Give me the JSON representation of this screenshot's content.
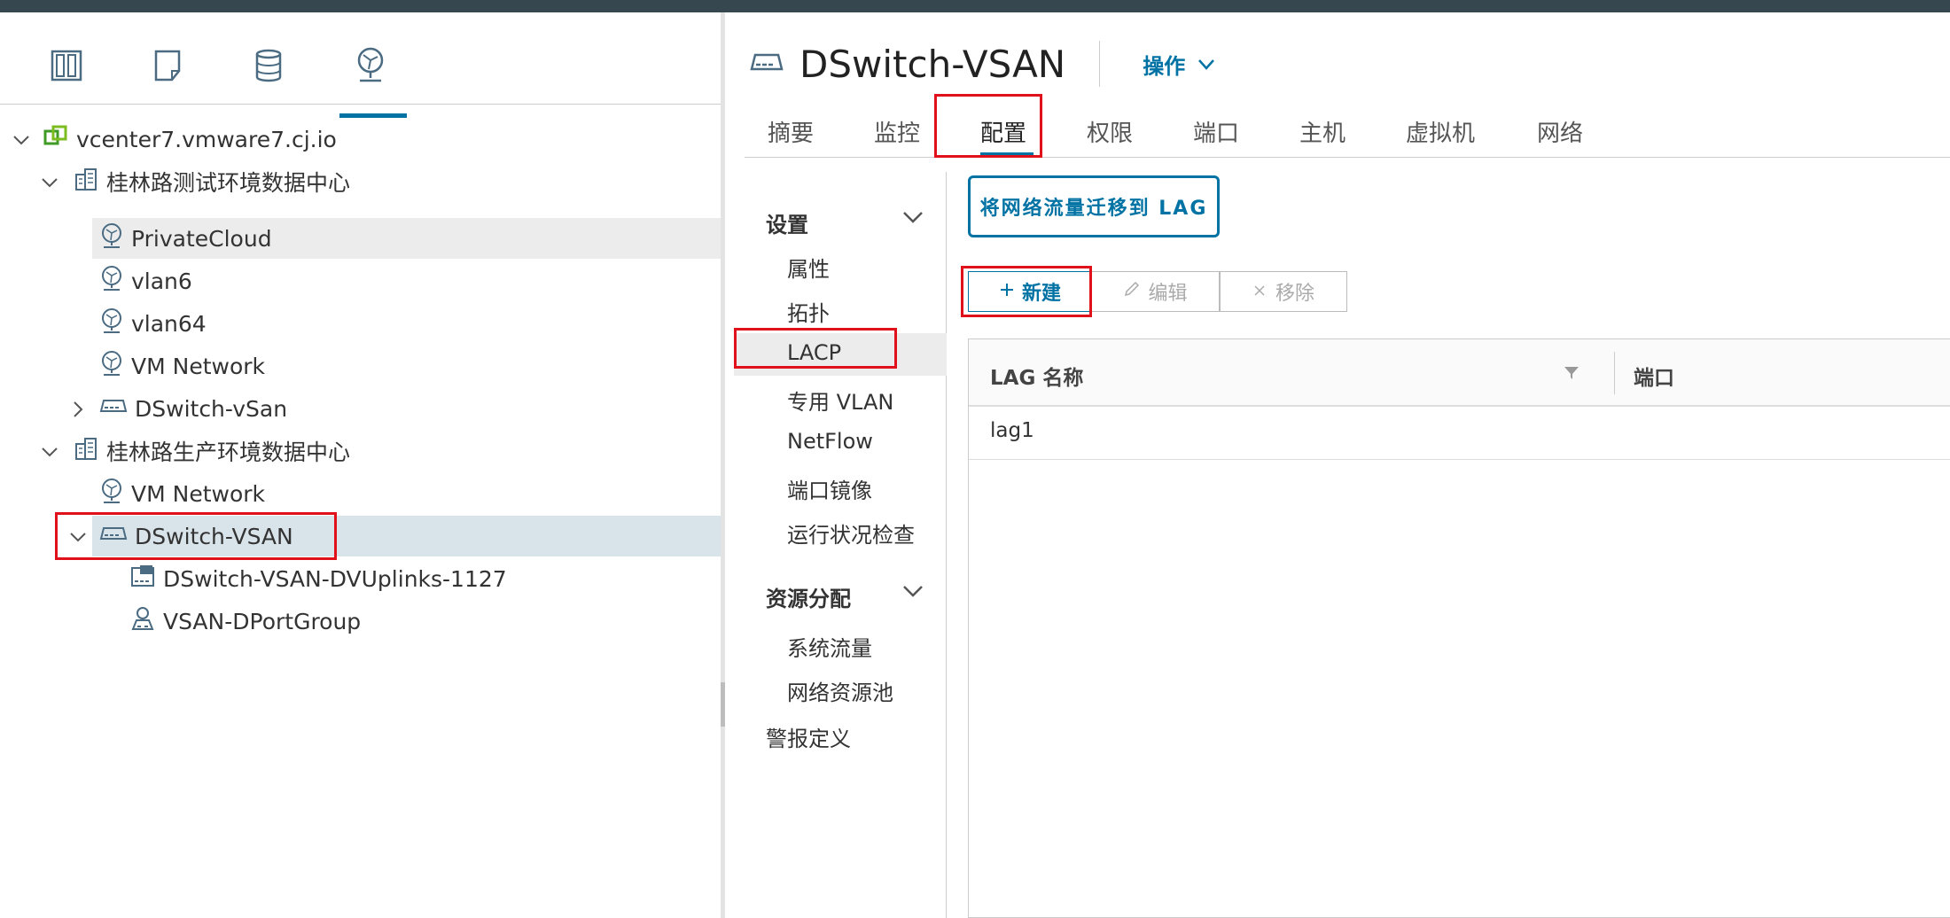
{
  "left_panel": {
    "view_tabs": [
      {
        "icon": "hosts-clusters-icon"
      },
      {
        "icon": "vms-templates-icon"
      },
      {
        "icon": "storage-icon"
      },
      {
        "icon": "networking-icon",
        "active": true
      }
    ],
    "tree": [
      {
        "label": "vcenter7.vmware7.cj.io",
        "icon": "vcenter-icon"
      },
      {
        "label": "桂林路测试环境数据中心",
        "icon": "datacenter-icon"
      },
      {
        "label": "PrivateCloud",
        "icon": "network-icon"
      },
      {
        "label": "vlan6",
        "icon": "network-icon"
      },
      {
        "label": "vlan64",
        "icon": "network-icon"
      },
      {
        "label": "VM Network",
        "icon": "network-icon"
      },
      {
        "label": "DSwitch-vSan",
        "icon": "dswitch-icon"
      },
      {
        "label": "桂林路生产环境数据中心",
        "icon": "datacenter-icon"
      },
      {
        "label": "VM Network",
        "icon": "network-icon"
      },
      {
        "label": "DSwitch-VSAN",
        "icon": "dswitch-icon"
      },
      {
        "label": "DSwitch-VSAN-DVUplinks-1127",
        "icon": "uplink-icon"
      },
      {
        "label": "VSAN-DPortGroup",
        "icon": "portgroup-icon"
      }
    ]
  },
  "header": {
    "title": "DSwitch-VSAN",
    "actions_label": "操作"
  },
  "tabs": [
    "摘要",
    "监控",
    "配置",
    "权限",
    "端口",
    "主机",
    "虚拟机",
    "网络"
  ],
  "subnav": {
    "settings_group": "设置",
    "settings_items": [
      "属性",
      "拓扑",
      "LACP",
      "专用 VLAN",
      "NetFlow",
      "端口镜像",
      "运行状况检查"
    ],
    "resource_group": "资源分配",
    "resource_items": [
      "系统流量",
      "网络资源池"
    ],
    "alarm_item": "警报定义"
  },
  "content": {
    "migrate_button": "将网络流量迁移到 LAG",
    "new_button": "新建",
    "edit_button": "编辑",
    "remove_button": "移除",
    "columns": [
      "LAG 名称",
      "端口"
    ],
    "rows": [
      [
        "lag1",
        ""
      ]
    ]
  },
  "colors": {
    "accent": "#0072a3",
    "highlight": "#e0111b",
    "topbar": "#37474f"
  }
}
